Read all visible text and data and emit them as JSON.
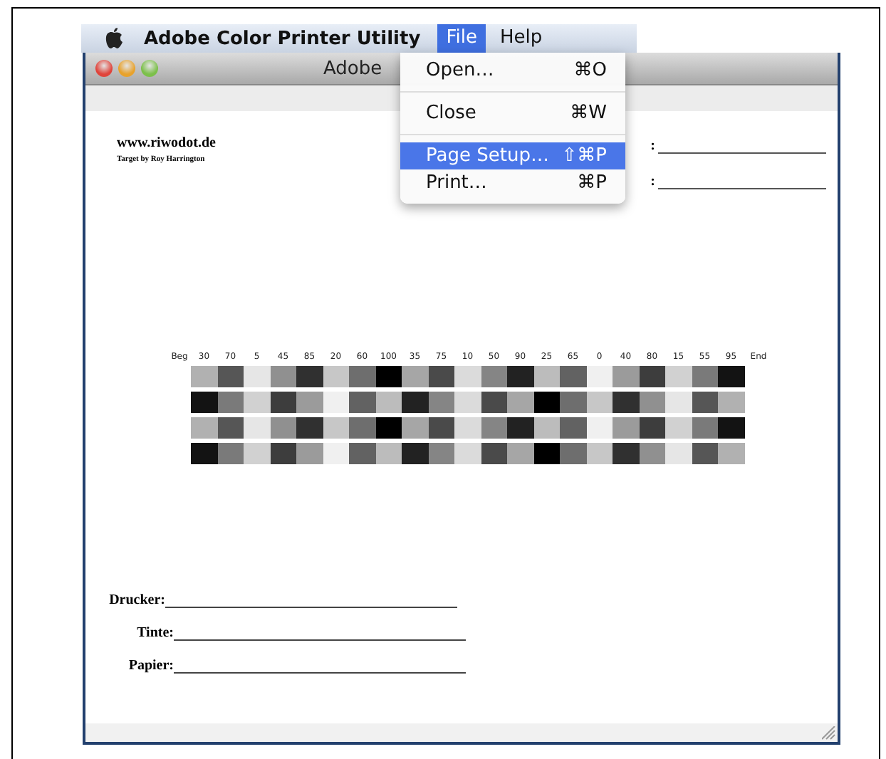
{
  "menubar": {
    "app_name": "Adobe Color Printer Utility",
    "menus": [
      {
        "label": "File",
        "selected": true
      },
      {
        "label": "Help",
        "selected": false
      }
    ]
  },
  "window": {
    "title": "Adobe"
  },
  "file_menu": [
    {
      "kind": "item",
      "label": "Open…",
      "shortcut": "⌘O",
      "selected": false
    },
    {
      "kind": "separator"
    },
    {
      "kind": "item",
      "label": "Close",
      "shortcut": "⌘W",
      "selected": false
    },
    {
      "kind": "separator"
    },
    {
      "kind": "item",
      "label": "Page Setup…",
      "shortcut": "⇧⌘P",
      "selected": true
    },
    {
      "kind": "item",
      "label": "Print…",
      "shortcut": "⌘P",
      "selected": false
    }
  ],
  "document": {
    "site": "www.riwodot.de",
    "credit": "Target by Roy Harrington",
    "top_fields": [
      {
        "label": ":"
      },
      {
        "label": ":"
      }
    ],
    "target": {
      "start_label": "Beg",
      "end_label": "End",
      "column_labels": [
        "30",
        "70",
        "5",
        "45",
        "85",
        "20",
        "60",
        "100",
        "35",
        "75",
        "10",
        "50",
        "90",
        "25",
        "65",
        "0",
        "40",
        "80",
        "15",
        "55",
        "95"
      ],
      "rows": [
        {
          "patches": [
            {
              "color": "#b1b1b1"
            },
            {
              "color": "#565656"
            },
            {
              "color": "#e6e6e6"
            },
            {
              "color": "#909090"
            },
            {
              "color": "#303030"
            },
            {
              "color": "#c7c7c7"
            },
            {
              "color": "#6e6e6e"
            },
            {
              "color": "#000000"
            },
            {
              "color": "#a6a6a6"
            },
            {
              "color": "#4a4a4a"
            },
            {
              "color": "#dbdbdb"
            },
            {
              "color": "#858585"
            },
            {
              "color": "#222222"
            },
            {
              "color": "#bcbcbc"
            },
            {
              "color": "#626262"
            },
            {
              "color": "#f0f0f0"
            },
            {
              "color": "#9b9b9b"
            },
            {
              "color": "#3d3d3d"
            },
            {
              "color": "#d1d1d1"
            },
            {
              "color": "#7a7a7a"
            },
            {
              "color": "#131313"
            }
          ]
        },
        {
          "patches": [
            {
              "color": "#131313"
            },
            {
              "color": "#7a7a7a"
            },
            {
              "color": "#d1d1d1"
            },
            {
              "color": "#3d3d3d"
            },
            {
              "color": "#9b9b9b"
            },
            {
              "color": "#f0f0f0"
            },
            {
              "color": "#626262"
            },
            {
              "color": "#bcbcbc"
            },
            {
              "color": "#222222"
            },
            {
              "color": "#858585"
            },
            {
              "color": "#dbdbdb"
            },
            {
              "color": "#4a4a4a"
            },
            {
              "color": "#a6a6a6"
            },
            {
              "color": "#000000"
            },
            {
              "color": "#6e6e6e"
            },
            {
              "color": "#c7c7c7"
            },
            {
              "color": "#303030"
            },
            {
              "color": "#909090"
            },
            {
              "color": "#e6e6e6"
            },
            {
              "color": "#565656"
            },
            {
              "color": "#b1b1b1"
            }
          ]
        },
        {
          "patches": [
            {
              "color": "#b1b1b1"
            },
            {
              "color": "#565656"
            },
            {
              "color": "#e6e6e6"
            },
            {
              "color": "#909090"
            },
            {
              "color": "#303030"
            },
            {
              "color": "#c7c7c7"
            },
            {
              "color": "#6e6e6e"
            },
            {
              "color": "#000000"
            },
            {
              "color": "#a6a6a6"
            },
            {
              "color": "#4a4a4a"
            },
            {
              "color": "#dbdbdb"
            },
            {
              "color": "#858585"
            },
            {
              "color": "#222222"
            },
            {
              "color": "#bcbcbc"
            },
            {
              "color": "#626262"
            },
            {
              "color": "#f0f0f0"
            },
            {
              "color": "#9b9b9b"
            },
            {
              "color": "#3d3d3d"
            },
            {
              "color": "#d1d1d1"
            },
            {
              "color": "#7a7a7a"
            },
            {
              "color": "#131313"
            }
          ]
        },
        {
          "patches": [
            {
              "color": "#131313"
            },
            {
              "color": "#7a7a7a"
            },
            {
              "color": "#d1d1d1"
            },
            {
              "color": "#3d3d3d"
            },
            {
              "color": "#9b9b9b"
            },
            {
              "color": "#f0f0f0"
            },
            {
              "color": "#626262"
            },
            {
              "color": "#bcbcbc"
            },
            {
              "color": "#222222"
            },
            {
              "color": "#858585"
            },
            {
              "color": "#dbdbdb"
            },
            {
              "color": "#4a4a4a"
            },
            {
              "color": "#a6a6a6"
            },
            {
              "color": "#000000"
            },
            {
              "color": "#6e6e6e"
            },
            {
              "color": "#c7c7c7"
            },
            {
              "color": "#303030"
            },
            {
              "color": "#909090"
            },
            {
              "color": "#e6e6e6"
            },
            {
              "color": "#565656"
            },
            {
              "color": "#b1b1b1"
            }
          ]
        }
      ]
    },
    "bottom_fields": [
      {
        "label": "Drucker:"
      },
      {
        "label": "Tinte:"
      },
      {
        "label": "Papier:"
      }
    ]
  }
}
